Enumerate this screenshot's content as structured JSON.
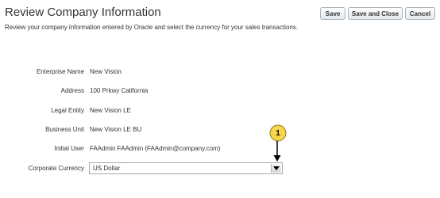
{
  "header": {
    "title": "Review Company Information",
    "subtitle": "Review your company information entered by Oracle and select the currency for your sales transactions."
  },
  "buttons": {
    "save": "Save",
    "save_and_close": "Save and Close",
    "cancel": "Cancel"
  },
  "form": {
    "enterprise_name": {
      "label": "Enterprise Name",
      "value": "New Vision"
    },
    "address": {
      "label": "Address",
      "value": "100 Prkwy California"
    },
    "legal_entity": {
      "label": "Legal Entity",
      "value": "New Vision LE"
    },
    "business_unit": {
      "label": "Business Unit",
      "value": "New Vision LE BU"
    },
    "initial_user": {
      "label": "Initial User",
      "value": "FAAdmin FAAdmin (FAAdmin@company.com)"
    },
    "corporate_currency": {
      "label": "Corporate Currency",
      "value": "US Dollar"
    }
  },
  "callout": {
    "number": "1"
  },
  "colors": {
    "callout_fill": "#f7d64a",
    "callout_stroke": "#8a7a20"
  },
  "icons": {
    "dropdown": "triangle-down-icon",
    "callout_arrow": "arrow-down-icon"
  }
}
